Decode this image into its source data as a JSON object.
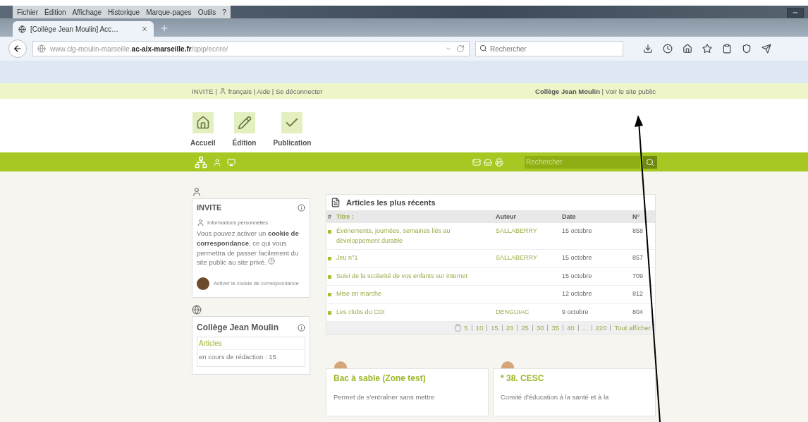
{
  "browser": {
    "menu": [
      "Fichier",
      "Édition",
      "Affichage",
      "Historique",
      "Marque-pages",
      "Outils",
      "?"
    ],
    "tabs": [
      {
        "title": "[Collège Jean Moulin] Acc…",
        "selected": true
      }
    ],
    "address": "www.clg-moulin-marseille.**ac-aix-marseille.fr**/spip/ecrire/",
    "search": {
      "placeholder": "Rechercher"
    }
  },
  "top_bar": {
    "user": "INVITE |",
    "links": "français | Aide | Se déconnecter",
    "site": "**Collège Jean Moulin** | Voir le site public"
  },
  "nav": [
    {
      "label": "Accueil",
      "kind": "home"
    },
    {
      "label": "Édition",
      "kind": "pencil"
    },
    {
      "label": "Publication",
      "kind": "check"
    }
  ],
  "toolbar": {
    "search": {
      "placeholder": "Rechercher"
    }
  },
  "visitor_card": {
    "title": "INVITE",
    "subtitle": "Informations personnelles",
    "text": "Vous pouvez activer un **cookie de correspondance**, ce qui vous permettra de passer facilement du site public au site privé.",
    "action": "Activer le cookie de correspondance"
  },
  "site_card": {
    "title": "Collège Jean Moulin",
    "section": "Articles",
    "line": "en cours de rédaction : 15"
  },
  "recent": {
    "title": "Articles les plus récents",
    "columns": [
      "#",
      "Titre :",
      "Auteur",
      "Date",
      "N°"
    ],
    "rows": [
      {
        "title": "Événements, journées, semaines liés au développement durable",
        "author": "SALLABERRY",
        "date": "15 octobre",
        "number": "858"
      },
      {
        "title": "Jeu n°1",
        "author": "SALLABERRY",
        "date": "15 octobre",
        "number": "857"
      },
      {
        "title": "Suivi de la scolarité de vos enfants sur internet",
        "date": "15 octobre",
        "number": "709"
      },
      {
        "title": "Mise en marche",
        "date": "12 octobre",
        "number": "812"
      },
      {
        "title": "Les clubs du CDI",
        "author": "DENGUIAC",
        "date": "9 octobre",
        "number": "804"
      }
    ],
    "pages": [
      "5",
      "10",
      "15",
      "20",
      "25",
      "30",
      "35",
      "40",
      "...",
      "220"
    ],
    "show_all": "Tout afficher"
  },
  "rubrics": [
    {
      "title": "Bac à sable (Zone test)",
      "text": "Permet de s'entraîner sans mettre"
    },
    {
      "title": "* 38. CESC",
      "text": "Comité d'éducation à la santé et à la"
    }
  ]
}
